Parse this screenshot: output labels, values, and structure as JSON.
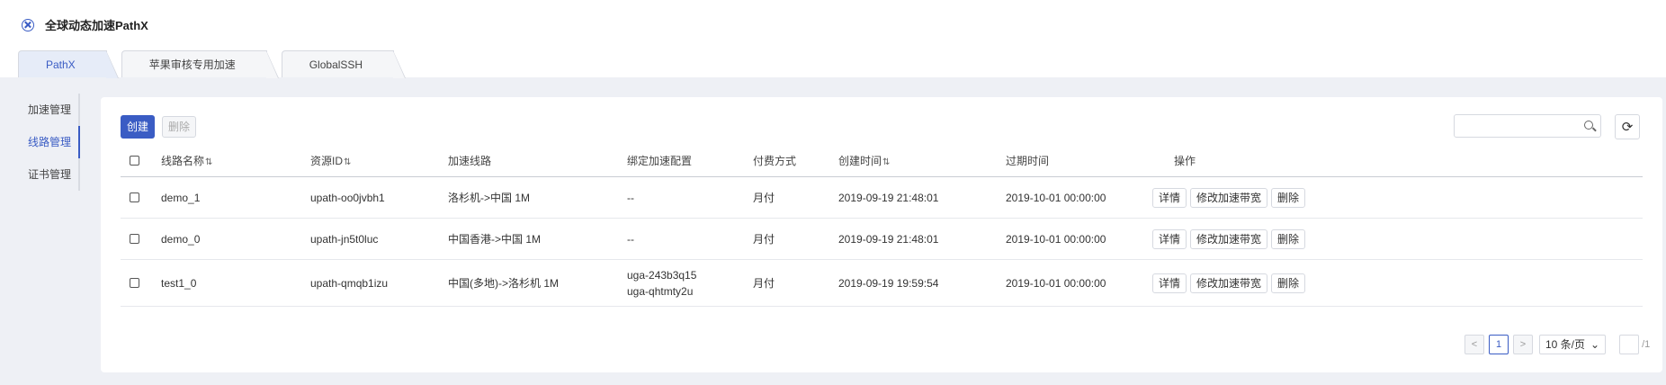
{
  "app": {
    "title": "全球动态加速PathX",
    "icon": "pathx-logo-icon"
  },
  "tabs": [
    {
      "label": "PathX",
      "active": true
    },
    {
      "label": "苹果审核专用加速",
      "active": false
    },
    {
      "label": "GlobalSSH",
      "active": false
    }
  ],
  "sidebar": {
    "items": [
      {
        "label": "加速管理",
        "active": false
      },
      {
        "label": "线路管理",
        "active": true
      },
      {
        "label": "证书管理",
        "active": false
      }
    ]
  },
  "toolbar": {
    "create_label": "创建",
    "delete_label": "删除",
    "search_placeholder": "",
    "refresh_icon": "refresh-icon"
  },
  "table": {
    "columns": {
      "name": "线路名称",
      "resource_id": "资源ID",
      "route": "加速线路",
      "config": "绑定加速配置",
      "payment": "付费方式",
      "created": "创建时间",
      "expires": "过期时间",
      "actions": "操作"
    },
    "rows": [
      {
        "name": "demo_1",
        "resource_id": "upath-oo0jvbh1",
        "route": "洛杉机->中国 1M",
        "config": [
          "--"
        ],
        "payment": "月付",
        "created": "2019-09-19 21:48:01",
        "expires": "2019-10-01 00:00:00"
      },
      {
        "name": "demo_0",
        "resource_id": "upath-jn5t0luc",
        "route": "中国香港->中国 1M",
        "config": [
          "--"
        ],
        "payment": "月付",
        "created": "2019-09-19 21:48:01",
        "expires": "2019-10-01 00:00:00"
      },
      {
        "name": "test1_0",
        "resource_id": "upath-qmqb1izu",
        "route": "中国(多地)->洛杉机 1M",
        "config": [
          "uga-243b3q15",
          "uga-qhtmty2u"
        ],
        "payment": "月付",
        "created": "2019-09-19 19:59:54",
        "expires": "2019-10-01 00:00:00"
      }
    ],
    "row_actions": {
      "detail": "详情",
      "modify": "修改加速带宽",
      "delete": "删除"
    }
  },
  "pagination": {
    "prev": "<",
    "current_page": "1",
    "next": ">",
    "page_size": "10 条/页",
    "total_pages": "/1"
  }
}
